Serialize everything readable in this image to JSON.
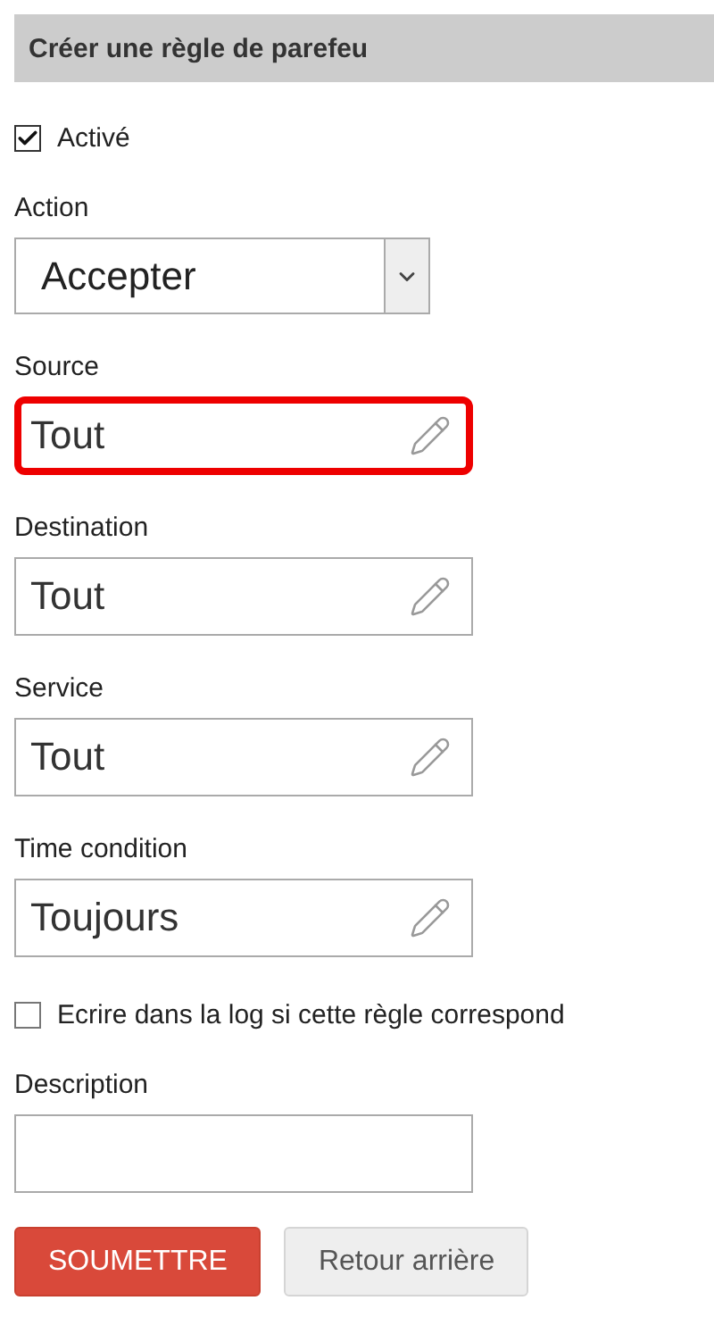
{
  "header": {
    "title": "Créer une règle de parefeu"
  },
  "fields": [
    {
      "kind": "checkbox",
      "label": "Activé",
      "checked": true
    },
    {
      "kind": "select",
      "label": "Action",
      "value": "Accepter"
    },
    {
      "kind": "picker",
      "label": "Source",
      "value": "Tout",
      "highlighted": true
    },
    {
      "kind": "picker",
      "label": "Destination",
      "value": "Tout",
      "highlighted": false
    },
    {
      "kind": "picker",
      "label": "Service",
      "value": "Tout",
      "highlighted": false
    },
    {
      "kind": "picker",
      "label": "Time condition",
      "value": "Toujours",
      "highlighted": false
    },
    {
      "kind": "checkbox",
      "label": "Ecrire dans la log si cette règle correspond",
      "checked": false
    },
    {
      "kind": "text",
      "label": "Description"
    }
  ],
  "buttons": [
    {
      "kind": "primary",
      "label": "SOUMETTRE"
    },
    {
      "kind": "secondary",
      "label": "Retour arrière"
    }
  ]
}
